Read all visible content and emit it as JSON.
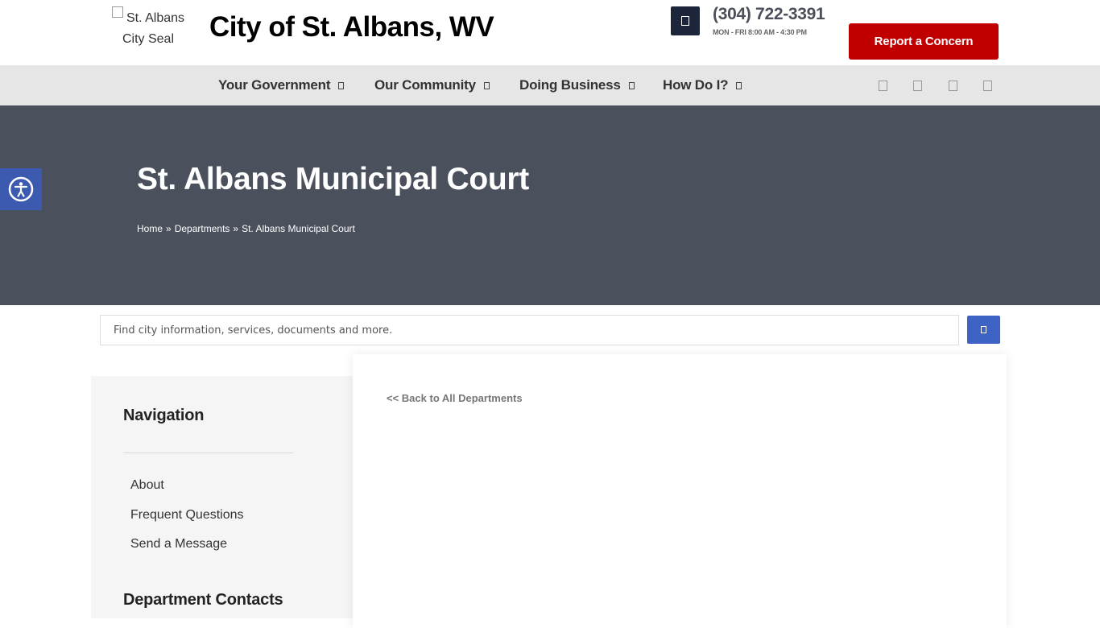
{
  "header": {
    "seal_alt": "St. Albans City Seal",
    "site_title": "City of St. Albans, WV",
    "phone_icon": "phone-icon",
    "phone_number": "(304) 722-3391",
    "hours": "MON - FRI  8:00 AM - 4:30 PM",
    "report_button": "Report a Concern",
    "colors": {
      "report": "#c00000",
      "phone_icon_bg": "#1c2539"
    }
  },
  "nav": {
    "items": [
      {
        "label": "Your Government"
      },
      {
        "label": "Our Community"
      },
      {
        "label": "Doing Business"
      },
      {
        "label": "How Do I?"
      }
    ],
    "social_icons": [
      "facebook-icon",
      "twitter-icon",
      "instagram-icon",
      "youtube-icon"
    ]
  },
  "hero": {
    "title": "St. Albans Municipal Court",
    "breadcrumb": [
      "Home",
      "Departments",
      "St. Albans Municipal Court"
    ],
    "breadcrumb_separator": "»",
    "background": "#4a505c"
  },
  "search": {
    "placeholder": "Find city information, services, documents and more.",
    "button_icon": "search-icon"
  },
  "sidebar": {
    "navigation_heading": "Navigation",
    "links": [
      "About",
      "Frequent Questions",
      "Send a Message"
    ],
    "contacts_heading": "Department Contacts"
  },
  "main": {
    "back_link": "<< Back to All Departments"
  },
  "accessibility": {
    "icon": "accessibility-icon",
    "color": "#3d5ab1"
  }
}
